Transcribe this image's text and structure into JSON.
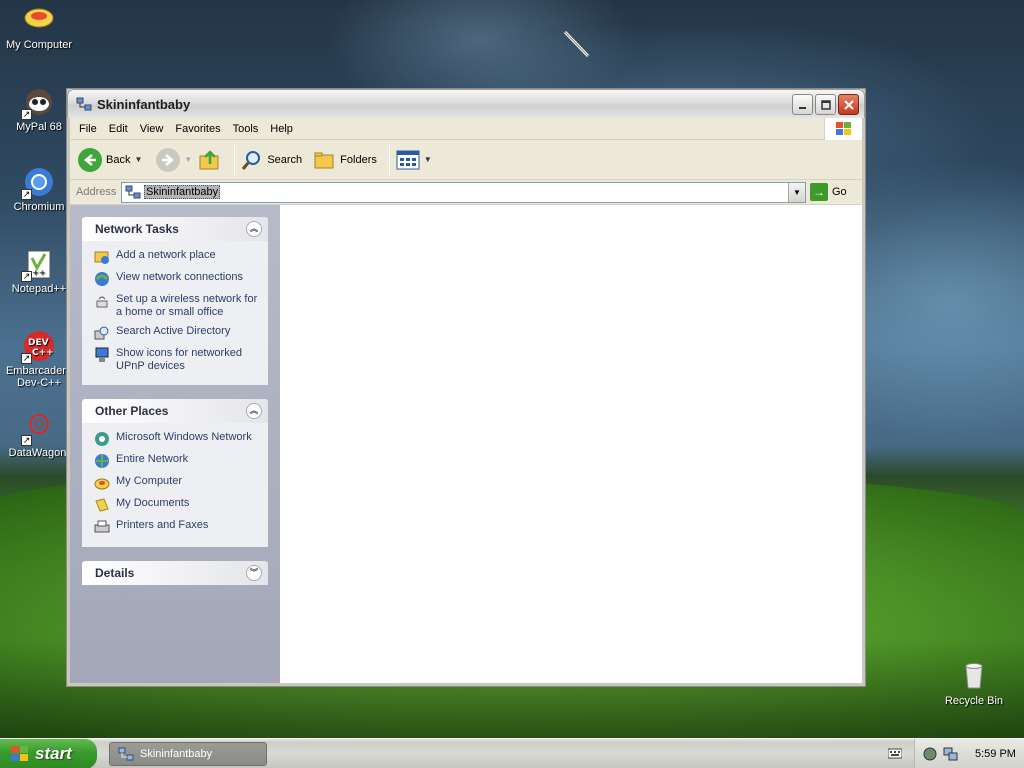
{
  "desktop": {
    "icons": [
      {
        "label": "My Computer",
        "icon": "my-computer-icon"
      },
      {
        "label": "MyPal 68",
        "icon": "mypal-browser-icon"
      },
      {
        "label": "Chromium",
        "icon": "chromium-icon"
      },
      {
        "label": "Notepad++",
        "icon": "notepadpp-icon"
      },
      {
        "label": "Embarcadero Dev-C++",
        "icon": "devcpp-icon"
      },
      {
        "label": "DataWagon.",
        "icon": "datawagon-icon"
      },
      {
        "label": "Recycle Bin",
        "icon": "recycle-bin-icon"
      }
    ]
  },
  "window": {
    "title": "Skininfantbaby",
    "menu": [
      "File",
      "Edit",
      "View",
      "Favorites",
      "Tools",
      "Help"
    ],
    "toolbar": {
      "back": "Back",
      "search": "Search",
      "folders": "Folders"
    },
    "address": {
      "label": "Address",
      "value": "Skininfantbaby",
      "go": "Go"
    },
    "panels": {
      "network_tasks": {
        "title": "Network Tasks",
        "items": [
          {
            "label": "Add a network place",
            "icon": "add-network-place-icon"
          },
          {
            "label": "View network connections",
            "icon": "network-connections-icon"
          },
          {
            "label": "Set up a wireless network for a home or small office",
            "icon": "wireless-icon"
          },
          {
            "label": "Search Active Directory",
            "icon": "search-directory-icon"
          },
          {
            "label": "Show icons for networked UPnP devices",
            "icon": "upnp-icon"
          }
        ]
      },
      "other_places": {
        "title": "Other Places",
        "items": [
          {
            "label": "Microsoft Windows Network",
            "icon": "windows-network-icon"
          },
          {
            "label": "Entire Network",
            "icon": "entire-network-icon"
          },
          {
            "label": "My Computer",
            "icon": "my-computer-icon"
          },
          {
            "label": "My Documents",
            "icon": "my-documents-icon"
          },
          {
            "label": "Printers and Faxes",
            "icon": "printers-icon"
          }
        ]
      },
      "details": {
        "title": "Details"
      }
    }
  },
  "taskbar": {
    "start": "start",
    "task_button": "Skininfantbaby",
    "clock": "5:59 PM"
  },
  "colors": {
    "start_green": "#3a9a2e",
    "link_blue": "#2d3e6a",
    "taskpane": "#a3a7b8"
  }
}
